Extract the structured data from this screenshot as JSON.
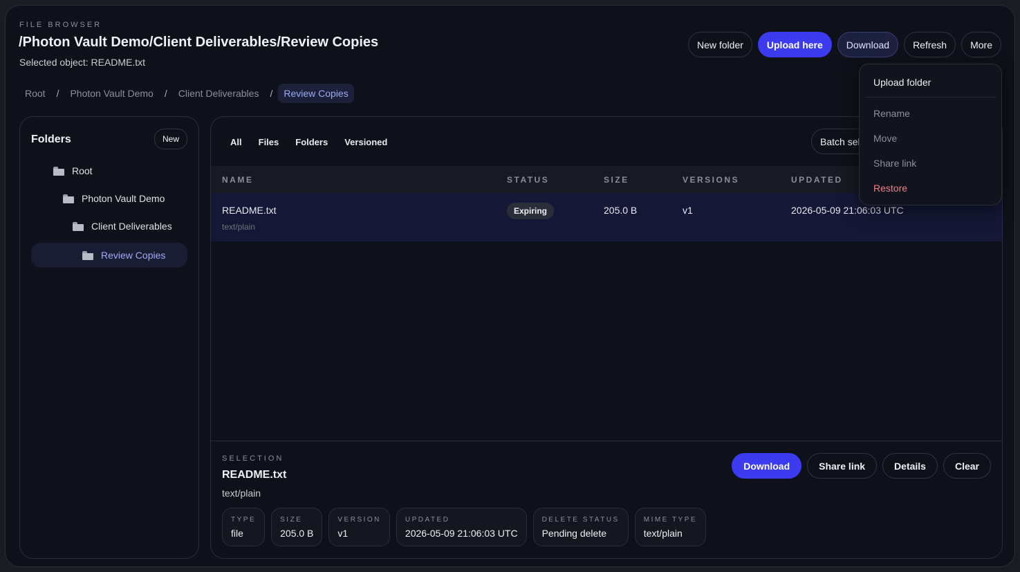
{
  "header": {
    "eyebrow": "FILE BROWSER",
    "path_title": "/Photon Vault Demo/Client Deliverables/Review Copies",
    "selected_object": "Selected object: README.txt"
  },
  "top_actions": {
    "new_folder": "New folder",
    "upload_here": "Upload here",
    "download": "Download",
    "refresh": "Refresh",
    "more": "More"
  },
  "breadcrumbs": [
    "Root",
    "Photon Vault Demo",
    "Client Deliverables",
    "Review Copies"
  ],
  "sidebar": {
    "title": "Folders",
    "new_label": "New",
    "items": [
      {
        "label": "Root",
        "icon": "folder-icon"
      },
      {
        "label": "Photon Vault Demo",
        "icon": "folder-icon"
      },
      {
        "label": "Client Deliverables",
        "icon": "folder-icon"
      },
      {
        "label": "Review Copies",
        "icon": "folder-icon",
        "selected": true
      }
    ]
  },
  "filters": {
    "tabs": [
      "All",
      "Files",
      "Folders",
      "Versioned"
    ],
    "batch_label": "Batch select"
  },
  "table": {
    "columns": [
      "NAME",
      "STATUS",
      "SIZE",
      "VERSIONS",
      "UPDATED"
    ],
    "rows": [
      {
        "name": "README.txt",
        "mime": "text/plain",
        "status": "Expiring",
        "size": "205.0 B",
        "versions": "v1",
        "updated": "2026-05-09 21:06:03 UTC"
      }
    ]
  },
  "selection": {
    "eyebrow": "SELECTION",
    "name": "README.txt",
    "mime": "text/plain",
    "actions": {
      "download": "Download",
      "share_link": "Share link",
      "details": "Details",
      "clear": "Clear"
    },
    "meta": [
      {
        "label": "TYPE",
        "value": "file"
      },
      {
        "label": "SIZE",
        "value": "205.0 B"
      },
      {
        "label": "VERSION",
        "value": "v1"
      },
      {
        "label": "UPDATED",
        "value": "2026-05-09 21:06:03 UTC"
      },
      {
        "label": "DELETE STATUS",
        "value": "Pending delete"
      },
      {
        "label": "MIME TYPE",
        "value": "text/plain"
      }
    ]
  },
  "more_menu": {
    "items": [
      "Upload folder",
      "Rename",
      "Move",
      "Share link",
      "Restore"
    ]
  },
  "colors": {
    "accent": "#3d3bf0",
    "danger": "#f27e8a",
    "background": "#0e1119"
  }
}
